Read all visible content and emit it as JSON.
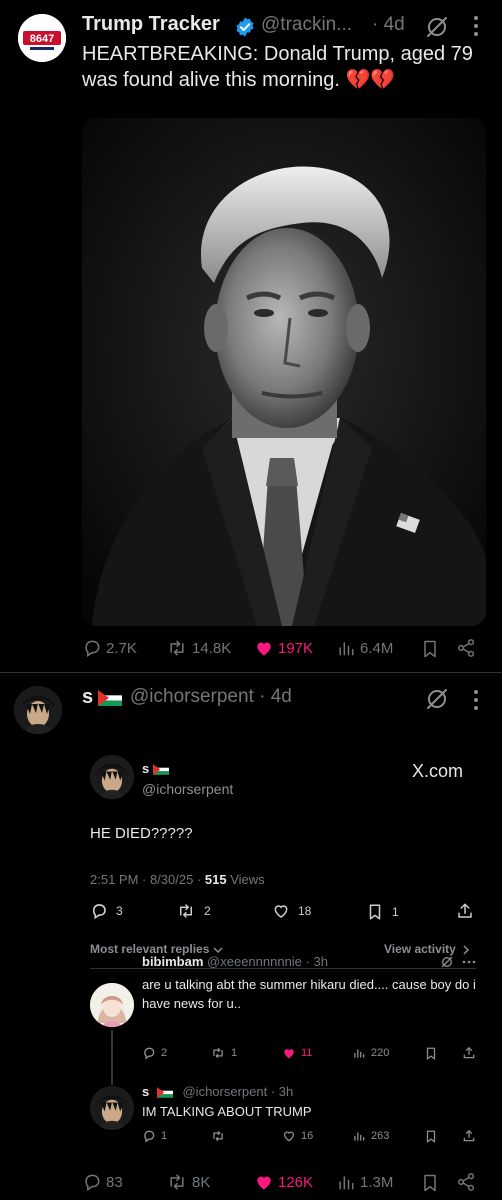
{
  "tweet1": {
    "avatar_text": "8647",
    "name": "Trump Tracker",
    "handle": "@trackin...",
    "time": "· 4d",
    "text": "HEARTBREAKING: Donald Trump, aged 79 was found alive this morning. 💔💔",
    "replies": "2.7K",
    "retweets": "14.8K",
    "likes": "197K",
    "views": "6.4M"
  },
  "tweet2": {
    "name": "s",
    "handle": "@ichorserpent · 4d",
    "embed": {
      "name": "s",
      "handle": "@ichorserpent",
      "source": "X.com",
      "text": "HE DIED?????",
      "meta_time": "2:51 PM · 8/30/25 · ",
      "meta_views_count": "515",
      "meta_views_label": " Views",
      "replies": "3",
      "retweets": "2",
      "likes": "18",
      "bookmarks": "1",
      "sort_label": "Most relevant replies",
      "view_activity": "View activity",
      "reply1": {
        "name": "bibimbam",
        "handle": "@xeeennnnnnie · 3h",
        "text": "are u talking abt the summer hikaru died.... cause boy do i have news for u..",
        "replies": "2",
        "retweets": "1",
        "likes": "11",
        "views": "220"
      },
      "reply2": {
        "name": "s",
        "handle": "@ichorserpent · 3h",
        "text": "IM TALKING ABOUT TRUMP",
        "replies": "1",
        "retweets": "",
        "likes": "16",
        "views": "263"
      }
    },
    "replies": "83",
    "retweets": "8K",
    "likes": "126K",
    "views": "1.3M"
  },
  "colors": {
    "like_active": "#f91880",
    "muted": "#71767b",
    "verified": "#1d9bf0"
  }
}
